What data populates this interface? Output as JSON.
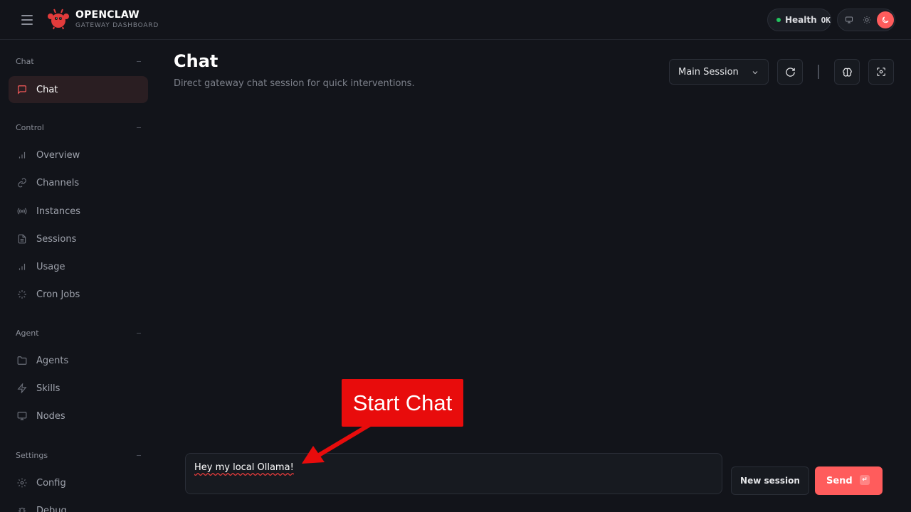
{
  "header": {
    "brand_title": "OPENCLAW",
    "brand_subtitle": "GATEWAY DASHBOARD",
    "health_label": "Health",
    "health_value": "OK",
    "health_color": "#22c55e",
    "accent_color": "#ff5c5c"
  },
  "sidebar": {
    "sections": [
      {
        "label": "Chat",
        "items": [
          {
            "label": "Chat",
            "icon": "message-icon",
            "active": true
          }
        ]
      },
      {
        "label": "Control",
        "items": [
          {
            "label": "Overview",
            "icon": "bar-chart-icon"
          },
          {
            "label": "Channels",
            "icon": "link-icon"
          },
          {
            "label": "Instances",
            "icon": "radio-icon"
          },
          {
            "label": "Sessions",
            "icon": "file-icon"
          },
          {
            "label": "Usage",
            "icon": "bar-chart-icon"
          },
          {
            "label": "Cron Jobs",
            "icon": "loader-icon"
          }
        ]
      },
      {
        "label": "Agent",
        "items": [
          {
            "label": "Agents",
            "icon": "folder-icon"
          },
          {
            "label": "Skills",
            "icon": "zap-icon"
          },
          {
            "label": "Nodes",
            "icon": "monitor-icon"
          }
        ]
      },
      {
        "label": "Settings",
        "items": [
          {
            "label": "Config",
            "icon": "gear-icon"
          },
          {
            "label": "Debug",
            "icon": "bug-icon"
          }
        ]
      }
    ]
  },
  "main": {
    "title": "Chat",
    "subtitle": "Direct gateway chat session for quick interventions.",
    "session_select": "Main Session",
    "composer_value": "Hey my local Ollama!",
    "new_session_label": "New session",
    "send_label": "Send",
    "send_shortcut": "↵"
  },
  "annotation": {
    "label": "Start Chat",
    "color": "#e80c0c"
  }
}
